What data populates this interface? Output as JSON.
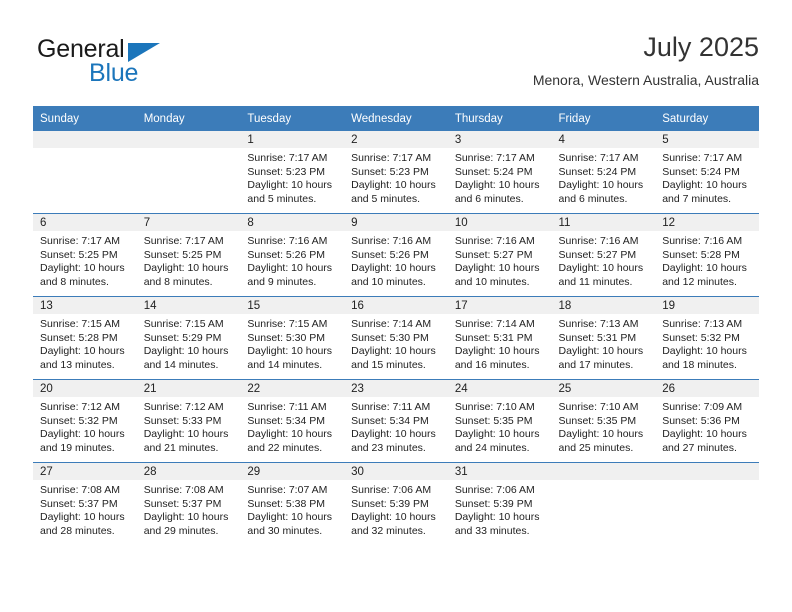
{
  "brand": {
    "name_top": "General",
    "name_bottom": "Blue",
    "triangle_color": "#1b75bb"
  },
  "header": {
    "title": "July 2025",
    "subtitle": "Menora, Western Australia, Australia"
  },
  "theme": {
    "header_blue": "#3c7cb9",
    "daystrip_gray": "#f0f0f0",
    "text": "#222222"
  },
  "weekdays": [
    "Sunday",
    "Monday",
    "Tuesday",
    "Wednesday",
    "Thursday",
    "Friday",
    "Saturday"
  ],
  "weeks": [
    [
      {
        "day": "",
        "sunrise": "",
        "sunset": "",
        "daylight": ""
      },
      {
        "day": "",
        "sunrise": "",
        "sunset": "",
        "daylight": ""
      },
      {
        "day": "1",
        "sunrise": "Sunrise: 7:17 AM",
        "sunset": "Sunset: 5:23 PM",
        "daylight": "Daylight: 10 hours and 5 minutes."
      },
      {
        "day": "2",
        "sunrise": "Sunrise: 7:17 AM",
        "sunset": "Sunset: 5:23 PM",
        "daylight": "Daylight: 10 hours and 5 minutes."
      },
      {
        "day": "3",
        "sunrise": "Sunrise: 7:17 AM",
        "sunset": "Sunset: 5:24 PM",
        "daylight": "Daylight: 10 hours and 6 minutes."
      },
      {
        "day": "4",
        "sunrise": "Sunrise: 7:17 AM",
        "sunset": "Sunset: 5:24 PM",
        "daylight": "Daylight: 10 hours and 6 minutes."
      },
      {
        "day": "5",
        "sunrise": "Sunrise: 7:17 AM",
        "sunset": "Sunset: 5:24 PM",
        "daylight": "Daylight: 10 hours and 7 minutes."
      }
    ],
    [
      {
        "day": "6",
        "sunrise": "Sunrise: 7:17 AM",
        "sunset": "Sunset: 5:25 PM",
        "daylight": "Daylight: 10 hours and 8 minutes."
      },
      {
        "day": "7",
        "sunrise": "Sunrise: 7:17 AM",
        "sunset": "Sunset: 5:25 PM",
        "daylight": "Daylight: 10 hours and 8 minutes."
      },
      {
        "day": "8",
        "sunrise": "Sunrise: 7:16 AM",
        "sunset": "Sunset: 5:26 PM",
        "daylight": "Daylight: 10 hours and 9 minutes."
      },
      {
        "day": "9",
        "sunrise": "Sunrise: 7:16 AM",
        "sunset": "Sunset: 5:26 PM",
        "daylight": "Daylight: 10 hours and 10 minutes."
      },
      {
        "day": "10",
        "sunrise": "Sunrise: 7:16 AM",
        "sunset": "Sunset: 5:27 PM",
        "daylight": "Daylight: 10 hours and 10 minutes."
      },
      {
        "day": "11",
        "sunrise": "Sunrise: 7:16 AM",
        "sunset": "Sunset: 5:27 PM",
        "daylight": "Daylight: 10 hours and 11 minutes."
      },
      {
        "day": "12",
        "sunrise": "Sunrise: 7:16 AM",
        "sunset": "Sunset: 5:28 PM",
        "daylight": "Daylight: 10 hours and 12 minutes."
      }
    ],
    [
      {
        "day": "13",
        "sunrise": "Sunrise: 7:15 AM",
        "sunset": "Sunset: 5:28 PM",
        "daylight": "Daylight: 10 hours and 13 minutes."
      },
      {
        "day": "14",
        "sunrise": "Sunrise: 7:15 AM",
        "sunset": "Sunset: 5:29 PM",
        "daylight": "Daylight: 10 hours and 14 minutes."
      },
      {
        "day": "15",
        "sunrise": "Sunrise: 7:15 AM",
        "sunset": "Sunset: 5:30 PM",
        "daylight": "Daylight: 10 hours and 14 minutes."
      },
      {
        "day": "16",
        "sunrise": "Sunrise: 7:14 AM",
        "sunset": "Sunset: 5:30 PM",
        "daylight": "Daylight: 10 hours and 15 minutes."
      },
      {
        "day": "17",
        "sunrise": "Sunrise: 7:14 AM",
        "sunset": "Sunset: 5:31 PM",
        "daylight": "Daylight: 10 hours and 16 minutes."
      },
      {
        "day": "18",
        "sunrise": "Sunrise: 7:13 AM",
        "sunset": "Sunset: 5:31 PM",
        "daylight": "Daylight: 10 hours and 17 minutes."
      },
      {
        "day": "19",
        "sunrise": "Sunrise: 7:13 AM",
        "sunset": "Sunset: 5:32 PM",
        "daylight": "Daylight: 10 hours and 18 minutes."
      }
    ],
    [
      {
        "day": "20",
        "sunrise": "Sunrise: 7:12 AM",
        "sunset": "Sunset: 5:32 PM",
        "daylight": "Daylight: 10 hours and 19 minutes."
      },
      {
        "day": "21",
        "sunrise": "Sunrise: 7:12 AM",
        "sunset": "Sunset: 5:33 PM",
        "daylight": "Daylight: 10 hours and 21 minutes."
      },
      {
        "day": "22",
        "sunrise": "Sunrise: 7:11 AM",
        "sunset": "Sunset: 5:34 PM",
        "daylight": "Daylight: 10 hours and 22 minutes."
      },
      {
        "day": "23",
        "sunrise": "Sunrise: 7:11 AM",
        "sunset": "Sunset: 5:34 PM",
        "daylight": "Daylight: 10 hours and 23 minutes."
      },
      {
        "day": "24",
        "sunrise": "Sunrise: 7:10 AM",
        "sunset": "Sunset: 5:35 PM",
        "daylight": "Daylight: 10 hours and 24 minutes."
      },
      {
        "day": "25",
        "sunrise": "Sunrise: 7:10 AM",
        "sunset": "Sunset: 5:35 PM",
        "daylight": "Daylight: 10 hours and 25 minutes."
      },
      {
        "day": "26",
        "sunrise": "Sunrise: 7:09 AM",
        "sunset": "Sunset: 5:36 PM",
        "daylight": "Daylight: 10 hours and 27 minutes."
      }
    ],
    [
      {
        "day": "27",
        "sunrise": "Sunrise: 7:08 AM",
        "sunset": "Sunset: 5:37 PM",
        "daylight": "Daylight: 10 hours and 28 minutes."
      },
      {
        "day": "28",
        "sunrise": "Sunrise: 7:08 AM",
        "sunset": "Sunset: 5:37 PM",
        "daylight": "Daylight: 10 hours and 29 minutes."
      },
      {
        "day": "29",
        "sunrise": "Sunrise: 7:07 AM",
        "sunset": "Sunset: 5:38 PM",
        "daylight": "Daylight: 10 hours and 30 minutes."
      },
      {
        "day": "30",
        "sunrise": "Sunrise: 7:06 AM",
        "sunset": "Sunset: 5:39 PM",
        "daylight": "Daylight: 10 hours and 32 minutes."
      },
      {
        "day": "31",
        "sunrise": "Sunrise: 7:06 AM",
        "sunset": "Sunset: 5:39 PM",
        "daylight": "Daylight: 10 hours and 33 minutes."
      },
      {
        "day": "",
        "sunrise": "",
        "sunset": "",
        "daylight": ""
      },
      {
        "day": "",
        "sunrise": "",
        "sunset": "",
        "daylight": ""
      }
    ]
  ]
}
